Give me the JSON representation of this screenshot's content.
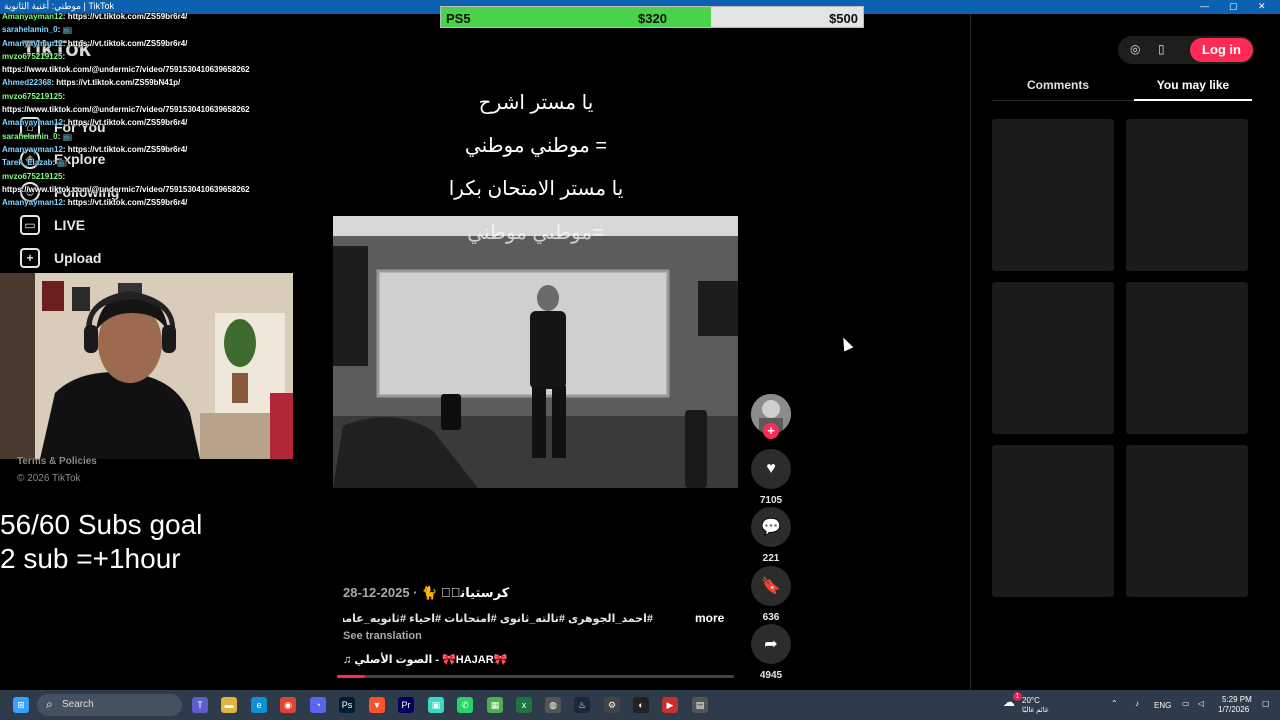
{
  "window": {
    "title": "موطني: أغنية الثانوية | TikTok",
    "controls": [
      "—",
      "▢",
      "✕"
    ]
  },
  "goal_bar": {
    "label": "PS5",
    "current": "$320",
    "target": "$500",
    "progress_fraction": 0.64
  },
  "tiktok": {
    "logo": "TikTok",
    "nav": [
      {
        "label": "For You",
        "icon": "home-icon"
      },
      {
        "label": "Explore",
        "icon": "compass-icon"
      },
      {
        "label": "Following",
        "icon": "user-icon"
      },
      {
        "label": "LIVE",
        "icon": "live-icon"
      },
      {
        "label": "Upload",
        "icon": "plus-square-icon"
      }
    ],
    "legal_link": "Terms & Policies",
    "copyright": "© 2026 TikTok"
  },
  "chat": [
    {
      "user": "Amanyayman12",
      "text": ": https://vt.tiktok.com/ZS59br6r4/"
    },
    {
      "user": "sarahelamin_0",
      "text": ": 📺"
    },
    {
      "user": "Amanyayman12",
      "text": ": https://vt.tiktok.com/ZS59br6r4/"
    },
    {
      "user": "mvzo675219125",
      "text": ":"
    },
    {
      "user": "",
      "text": "https://www.tiktok.com/@undermic7/video/7591530410639658262"
    },
    {
      "user": "Ahmed22368",
      "text": ": https://vt.tiktok.com/ZS59bN41p/"
    },
    {
      "user": "mvzo675219125",
      "text": ":"
    },
    {
      "user": "",
      "text": "https://www.tiktok.com/@undermic7/video/7591530410639658262"
    },
    {
      "user": "Amanyayman12",
      "text": ": https://vt.tiktok.com/ZS59br6r4/"
    },
    {
      "user": "sarahelamin_0",
      "text": ": 📺"
    },
    {
      "user": "Amanyayman12",
      "text": ": https://vt.tiktok.com/ZS59br6r4/"
    },
    {
      "user": "Tarek_Elazab",
      "text": ": 📺"
    },
    {
      "user": "mvzo675219125",
      "text": ":"
    },
    {
      "user": "",
      "text": "https://www.tiktok.com/@undermic7/video/7591530410639658262"
    },
    {
      "user": "Amanyayman12",
      "text": ": https://vt.tiktok.com/ZS59br6r4/"
    }
  ],
  "subs_goal": {
    "line1": "56/60 Subs goal",
    "line2": "2 sub =+1hour"
  },
  "video": {
    "captions": [
      "يا مستر اشرح",
      "= موطني موطني",
      "يا مستر الامتحان بكرا"
    ],
    "overlay_text": "=موطني موطني",
    "author": "كرستيانوۨ 🐈",
    "date": "· 2025-12-28",
    "hashtags": "#احمد_الجوهرى #تالته_ثانوى #امتحانات #احياء #ثانويه_عامه...",
    "more": "more",
    "see_translation": "See translation",
    "sound": "الصوت الأصلي - 🎀HAJAR🎀",
    "progress_fraction": 0.07
  },
  "actions": {
    "likes": "7105",
    "comments": "221",
    "saves": "636",
    "shares": "4945"
  },
  "right_panel": {
    "login": "Log in",
    "tabs": [
      "Comments",
      "You may like"
    ],
    "active_tab": "You may like"
  },
  "taskbar": {
    "search": "Search",
    "weather_temp": "20°C",
    "weather_desc": "غائم غالبًا",
    "weather_badge": "1",
    "lang": "ENG",
    "time": "5:29 PM",
    "date": "1/7/2026"
  },
  "colors": {
    "tiktok_red": "#fe2c55",
    "goal_green": "#4bd24b",
    "titlebar_blue": "#0c62b0"
  }
}
